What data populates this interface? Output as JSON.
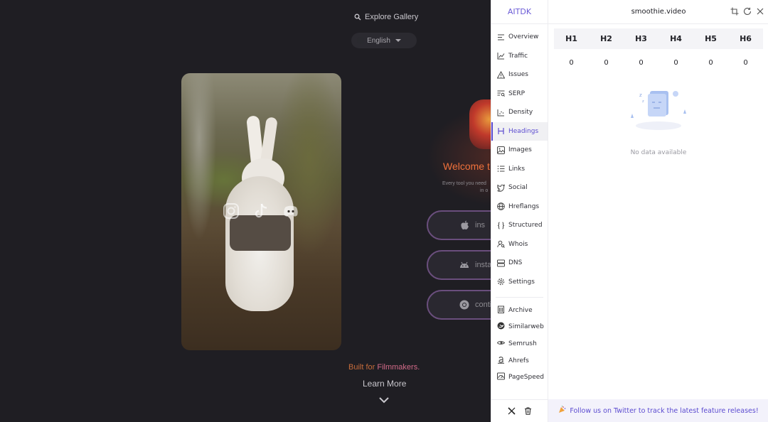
{
  "site": {
    "explore_label": "Explore Gallery",
    "language": "English",
    "welcome": "Welcome t",
    "tagline_1": "Every tool you need",
    "tagline_2": "in o",
    "buttons": [
      {
        "label": "ins",
        "icon": "apple-icon"
      },
      {
        "label": "insta",
        "icon": "android-icon"
      },
      {
        "label": "conti",
        "icon": "chrome-icon"
      }
    ],
    "built_prefix": "Built for ",
    "built_highlight": "Filmmakers.",
    "learn_more": "Learn More",
    "social_icons": [
      "instagram-icon",
      "tiktok-icon",
      "discord-icon"
    ]
  },
  "panel": {
    "logo": "AITDK",
    "domain": "smoothie.video",
    "nav": [
      {
        "label": "Overview",
        "icon": "overview-icon",
        "active": false
      },
      {
        "label": "Traffic",
        "icon": "traffic-icon",
        "active": false
      },
      {
        "label": "Issues",
        "icon": "warning-icon",
        "active": false
      },
      {
        "label": "SERP",
        "icon": "serp-icon",
        "active": false
      },
      {
        "label": "Density",
        "icon": "density-icon",
        "active": false
      },
      {
        "label": "Headings",
        "icon": "heading-icon",
        "active": true
      },
      {
        "label": "Images",
        "icon": "image-icon",
        "active": false
      },
      {
        "label": "Links",
        "icon": "links-icon",
        "active": false
      },
      {
        "label": "Social",
        "icon": "twitter-icon",
        "active": false
      },
      {
        "label": "Hreflangs",
        "icon": "globe-icon",
        "active": false
      },
      {
        "label": "Structured",
        "icon": "braces-icon",
        "active": false
      },
      {
        "label": "Whois",
        "icon": "user-search-icon",
        "active": false
      },
      {
        "label": "DNS",
        "icon": "server-icon",
        "active": false
      },
      {
        "label": "Settings",
        "icon": "gear-icon",
        "active": false
      }
    ],
    "external": [
      {
        "label": "Archive",
        "icon": "archive-icon"
      },
      {
        "label": "Similarweb",
        "icon": "similarweb-icon"
      },
      {
        "label": "Semrush",
        "icon": "semrush-icon"
      },
      {
        "label": "Ahrefs",
        "icon": "ahrefs-icon"
      },
      {
        "label": "PageSpeed",
        "icon": "pagespeed-icon"
      }
    ],
    "headings": {
      "labels": [
        "H1",
        "H2",
        "H3",
        "H4",
        "H5",
        "H6"
      ],
      "counts": [
        "0",
        "0",
        "0",
        "0",
        "0",
        "0"
      ]
    },
    "empty_text": "No data available",
    "footer_text": "Follow us on Twitter to track the latest feature releases!",
    "accent": "#5b4bd0"
  }
}
